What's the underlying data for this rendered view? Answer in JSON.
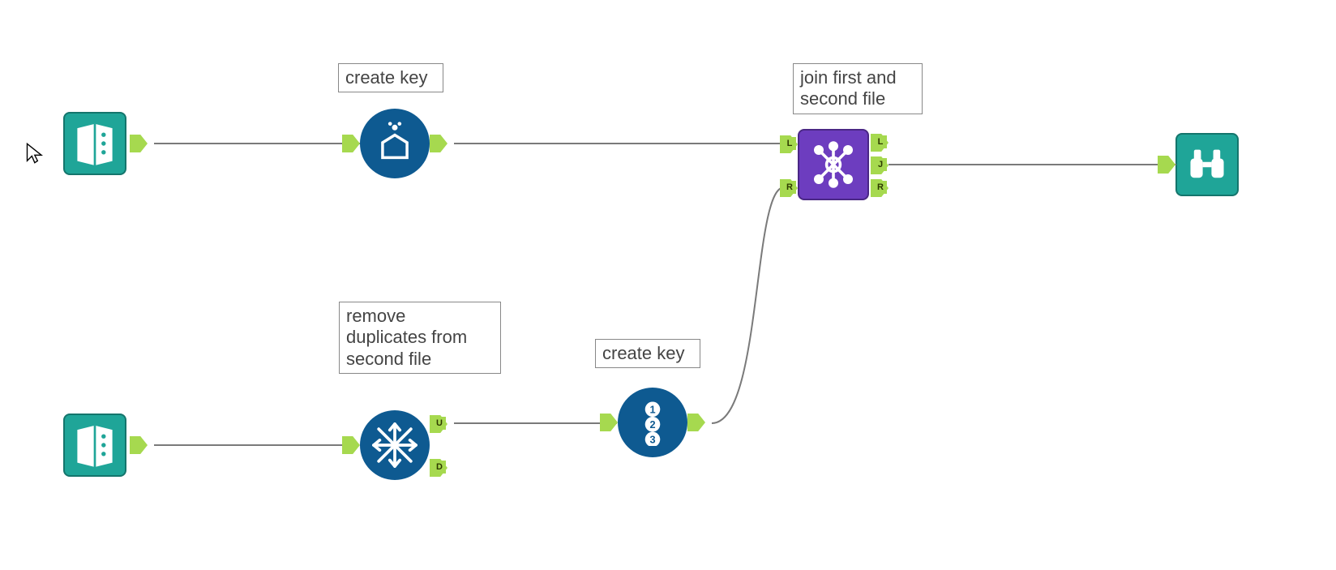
{
  "annotations": {
    "create_key_1": "create key",
    "remove_dup": "remove\nduplicates from\nsecond file",
    "create_key_2": "create key",
    "join": "join first and\nsecond file"
  },
  "port_labels": {
    "unique_L": "L",
    "unique_R": "R",
    "join_out_L": "L",
    "join_out_J": "J",
    "join_out_R": "R",
    "dedupe_U": "U",
    "dedupe_D": "D"
  },
  "nodes": {
    "input1": {
      "type": "input",
      "icon": "file-input"
    },
    "input2": {
      "type": "input",
      "icon": "file-input"
    },
    "formula1": {
      "type": "formula",
      "icon": "formula-drop"
    },
    "unique": {
      "type": "unique",
      "icon": "snowflake"
    },
    "recordid": {
      "type": "record-id",
      "icon": "numbered-circle"
    },
    "join": {
      "type": "join",
      "icon": "network-cross"
    },
    "browse": {
      "type": "browse",
      "icon": "binoculars"
    }
  },
  "colors": {
    "teal": "#1fa598",
    "blue": "#0e5a91",
    "purple": "#6d3dbf",
    "port_green": "#a6d94f",
    "wire": "#7a7a7a"
  }
}
